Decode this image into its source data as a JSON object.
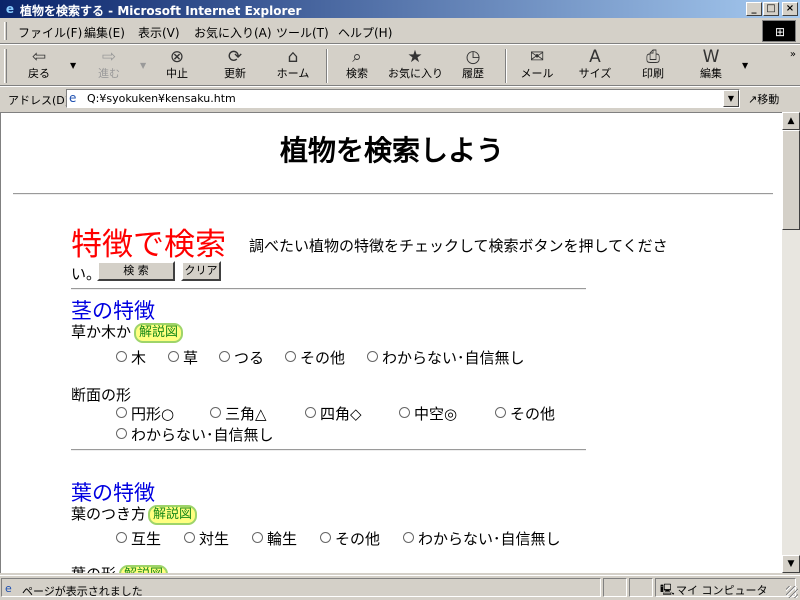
{
  "window": {
    "title": "植物を検索する - Microsoft Internet Explorer",
    "controls": {
      "minimize": "_",
      "maximize": "□",
      "close": "×"
    }
  },
  "menu": [
    "ファイル(F)",
    "編集(E)",
    "表示(V)",
    "お気に入り(A)",
    "ツール(T)",
    "ヘルプ(H)"
  ],
  "toolbar": {
    "back": "戻る",
    "forward": "進む",
    "stop": "中止",
    "refresh": "更新",
    "home": "ホーム",
    "search": "検索",
    "favorites": "お気に入り",
    "history": "履歴",
    "mail": "メール",
    "size": "サイズ",
    "print": "印刷",
    "edit": "編集",
    "more": "»"
  },
  "address": {
    "label": "アドレス(D)",
    "value": "Q:¥syokuken¥kensaku.htm",
    "go": "移動"
  },
  "page": {
    "title": "植物を検索しよう",
    "search_heading": "特徴で検索",
    "instruction_1": "調べたい植物の特徴をチェックして検索ボタンを押してくださ",
    "instruction_2": "い。",
    "search_button": "検 索",
    "clear_button": "クリア",
    "stem_section": {
      "heading": "茎の特徴",
      "type_label": "草か木か",
      "type_diagram": "解説図",
      "type_options": [
        "木",
        "草",
        "つる",
        "その他",
        "わからない･自信無し"
      ],
      "cross_section_label": "断面の形",
      "cross_section_options": [
        "円形○",
        "三角△",
        "四角◇",
        "中空◎",
        "その他",
        "わからない･自信無し"
      ]
    },
    "leaf_section": {
      "heading": "葉の特徴",
      "arrangement_label": "葉のつき方",
      "arrangement_diagram": "解説図",
      "arrangement_options": [
        "互生",
        "対生",
        "輪生",
        "その他",
        "わからない･自信無し"
      ],
      "shape_label": "葉の形",
      "shape_diagram": "解説図"
    }
  },
  "status": {
    "text": "ページが表示されました",
    "zone": "マイ コンピュータ"
  }
}
